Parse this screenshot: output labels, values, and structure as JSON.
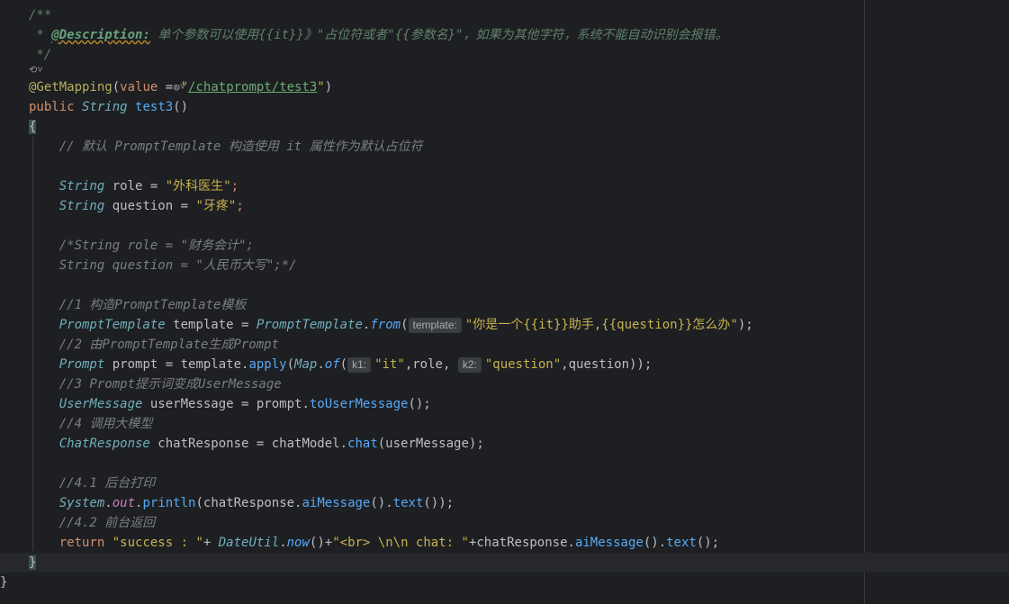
{
  "editor": {
    "lines": [
      {
        "id": "l1",
        "segments": [
          {
            "t": "/**",
            "c": "c-doc"
          }
        ]
      },
      {
        "id": "l2",
        "segments": [
          {
            "t": " * ",
            "c": "c-doc"
          },
          {
            "t": "@Description:",
            "c": "c-tag"
          },
          {
            "t": " 单个参数可以使用{{it}}》\"占位符或者\"{{参数名}\"，如果为其他字符，系统不能自动识别会报错。",
            "c": "c-doc"
          }
        ]
      },
      {
        "id": "l3",
        "segments": [
          {
            "t": " */",
            "c": "c-doc"
          }
        ]
      },
      {
        "id": "l4",
        "segments": []
      },
      {
        "id": "l5",
        "segments": [
          {
            "t": "@GetMapping",
            "c": "c-anno"
          },
          {
            "t": "(",
            "c": "c-punc"
          },
          {
            "t": "value",
            "c": "c-kw"
          },
          {
            "t": " = ",
            "c": "c-punc"
          },
          {
            "t": "\"",
            "c": "c-str-yellow"
          },
          {
            "t": "/chatprompt/test3",
            "c": "underline-url"
          },
          {
            "t": "\"",
            "c": "c-str-yellow"
          },
          {
            "t": ")",
            "c": "c-punc"
          }
        ]
      },
      {
        "id": "l6",
        "segments": [
          {
            "t": "public ",
            "c": "c-kw"
          },
          {
            "t": "String ",
            "c": "c-type"
          },
          {
            "t": "test3",
            "c": "c-method"
          },
          {
            "t": "()",
            "c": "c-punc"
          }
        ]
      },
      {
        "id": "l7",
        "segments": [
          {
            "t": "{",
            "c": "brace-hl"
          }
        ]
      },
      {
        "id": "l8",
        "segments": [
          {
            "t": "    // 默认 PromptTemplate 构造使用 it 属性作为默认占位符",
            "c": "c-comment"
          }
        ]
      },
      {
        "id": "l9",
        "segments": []
      },
      {
        "id": "l10",
        "segments": [
          {
            "t": "    "
          },
          {
            "t": "String",
            "c": "c-type"
          },
          {
            "t": " role = "
          },
          {
            "t": "\"外科医生\"",
            "c": "c-str-yellow"
          },
          {
            "t": ";",
            "c": "c-kw"
          }
        ]
      },
      {
        "id": "l11",
        "segments": [
          {
            "t": "    "
          },
          {
            "t": "String",
            "c": "c-type"
          },
          {
            "t": " question = "
          },
          {
            "t": "\"牙疼\"",
            "c": "c-str-yellow"
          },
          {
            "t": ";",
            "c": "c-kw"
          }
        ]
      },
      {
        "id": "l12",
        "segments": []
      },
      {
        "id": "l13",
        "segments": [
          {
            "t": "    /*String role = \"财务会计\";",
            "c": "c-comment"
          }
        ]
      },
      {
        "id": "l14",
        "segments": [
          {
            "t": "    String question = \"人民币大写\";*/",
            "c": "c-comment"
          }
        ]
      },
      {
        "id": "l15",
        "segments": []
      },
      {
        "id": "l16",
        "segments": [
          {
            "t": "    //1 构造PromptTemplate模板",
            "c": "c-comment"
          }
        ]
      },
      {
        "id": "l17",
        "segments": [
          {
            "t": "    "
          },
          {
            "t": "PromptTemplate",
            "c": "c-type"
          },
          {
            "t": " template = "
          },
          {
            "t": "PromptTemplate",
            "c": "c-type"
          },
          {
            "t": "."
          },
          {
            "t": "from",
            "c": "c-static"
          },
          {
            "t": "("
          },
          {
            "hint": "template:"
          },
          {
            "t": "\"你是一个{{it}}助手,{{question}}怎么办\"",
            "c": "c-str-yellow"
          },
          {
            "t": ");"
          }
        ]
      },
      {
        "id": "l18",
        "segments": [
          {
            "t": "    //2 由PromptTemplate生成Prompt",
            "c": "c-comment"
          }
        ]
      },
      {
        "id": "l19",
        "segments": [
          {
            "t": "    "
          },
          {
            "t": "Prompt",
            "c": "c-type"
          },
          {
            "t": " prompt = template."
          },
          {
            "t": "apply",
            "c": "c-call"
          },
          {
            "t": "("
          },
          {
            "t": "Map",
            "c": "c-type"
          },
          {
            "t": "."
          },
          {
            "t": "of",
            "c": "c-static"
          },
          {
            "t": "("
          },
          {
            "hint": "k1:"
          },
          {
            "t": "\"it\"",
            "c": "c-str-yellow"
          },
          {
            "t": ",role, "
          },
          {
            "hint": "k2:"
          },
          {
            "t": "\"question\"",
            "c": "c-str-yellow"
          },
          {
            "t": ",question));"
          }
        ]
      },
      {
        "id": "l20",
        "segments": [
          {
            "t": "    //3 Prompt提示词变成UserMessage",
            "c": "c-comment"
          }
        ]
      },
      {
        "id": "l21",
        "segments": [
          {
            "t": "    "
          },
          {
            "t": "UserMessage",
            "c": "c-type"
          },
          {
            "t": " userMessage = prompt."
          },
          {
            "t": "toUserMessage",
            "c": "c-call"
          },
          {
            "t": "();"
          }
        ]
      },
      {
        "id": "l22",
        "segments": [
          {
            "t": "    //4 调用大模型",
            "c": "c-comment"
          }
        ]
      },
      {
        "id": "l23",
        "segments": [
          {
            "t": "    "
          },
          {
            "t": "ChatResponse",
            "c": "c-type"
          },
          {
            "t": " chatResponse = chatModel."
          },
          {
            "t": "chat",
            "c": "c-call"
          },
          {
            "t": "(userMessage);"
          }
        ]
      },
      {
        "id": "l24",
        "segments": []
      },
      {
        "id": "l25",
        "segments": [
          {
            "t": "    //4.1 后台打印",
            "c": "c-comment"
          }
        ]
      },
      {
        "id": "l26",
        "segments": [
          {
            "t": "    "
          },
          {
            "t": "System",
            "c": "c-type"
          },
          {
            "t": "."
          },
          {
            "t": "out",
            "c": "c-field"
          },
          {
            "t": "."
          },
          {
            "t": "println",
            "c": "c-call"
          },
          {
            "t": "(chatResponse."
          },
          {
            "t": "aiMessage",
            "c": "c-call"
          },
          {
            "t": "()."
          },
          {
            "t": "text",
            "c": "c-call"
          },
          {
            "t": "());"
          }
        ]
      },
      {
        "id": "l27",
        "segments": [
          {
            "t": "    //4.2 前台返回",
            "c": "c-comment"
          }
        ]
      },
      {
        "id": "l28",
        "segments": [
          {
            "t": "    "
          },
          {
            "t": "return ",
            "c": "c-kw"
          },
          {
            "t": "\"success : \"",
            "c": "c-str-yellow"
          },
          {
            "t": "+ "
          },
          {
            "t": "DateUtil",
            "c": "c-type"
          },
          {
            "t": "."
          },
          {
            "t": "now",
            "c": "c-static"
          },
          {
            "t": "()+"
          },
          {
            "t": "\"<br> \\n\\n chat: \"",
            "c": "c-str-yellow"
          },
          {
            "t": "+chatResponse."
          },
          {
            "t": "aiMessage",
            "c": "c-call"
          },
          {
            "t": "()."
          },
          {
            "t": "text",
            "c": "c-call"
          },
          {
            "t": "();"
          }
        ]
      },
      {
        "id": "l29",
        "segments": [
          {
            "t": "}",
            "c": "brace-hl"
          }
        ]
      },
      {
        "id": "l30",
        "segments": [
          {
            "t": "}"
          }
        ]
      }
    ]
  }
}
